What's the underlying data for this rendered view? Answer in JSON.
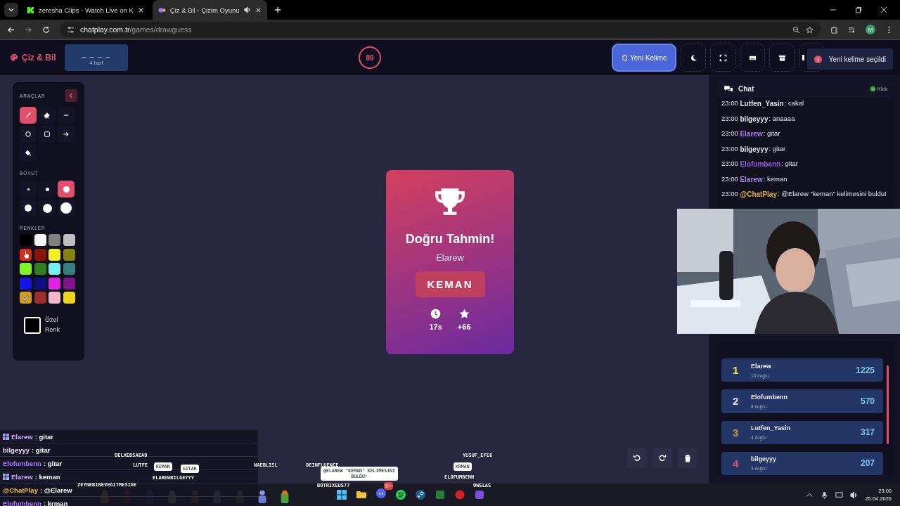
{
  "browser": {
    "tabs": [
      {
        "title": "zeresha Clips - Watch Live on K",
        "selected": false,
        "kind": "kick"
      },
      {
        "title": "Çiz & Bil - Çizim Oyunu",
        "selected": true,
        "kind": "cp"
      }
    ],
    "url_host": "chatplay.com.tr",
    "url_path": "/games/drawguess",
    "profile": "M"
  },
  "header": {
    "logo": "Çiz & Bil",
    "word": "_ _ _ _",
    "letters": "4 harf",
    "timer": "89",
    "new_word": "Yeni Kelime",
    "toast": "Yeni kelime seçildi"
  },
  "tools_panel": {
    "title": "ARAÇLAR",
    "tools": [
      {
        "kind": "brush",
        "selected": true
      },
      {
        "kind": "eraser",
        "selected": false
      },
      {
        "kind": "line",
        "selected": false
      },
      {
        "kind": "circle",
        "selected": false
      },
      {
        "kind": "rect",
        "selected": false
      },
      {
        "kind": "arrow",
        "selected": false
      },
      {
        "kind": "fill",
        "selected": false
      }
    ],
    "size_title": "BOYUT",
    "sizes": [
      {
        "selected": false
      },
      {
        "selected": false
      },
      {
        "selected": true
      },
      {
        "selected": false
      },
      {
        "selected": false
      },
      {
        "selected": false
      }
    ],
    "color_title": "RENKLER",
    "colors": [
      {
        "color": "#000000",
        "selected": false
      },
      {
        "color": "#f5f5f5",
        "selected": false
      },
      {
        "color": "#808080",
        "selected": false
      },
      {
        "color": "#c0c0c0",
        "selected": false
      },
      {
        "color": "#e02a14",
        "selected": false
      },
      {
        "color": "#8b1408",
        "selected": false
      },
      {
        "color": "#f2f020",
        "selected": false
      },
      {
        "color": "#848414",
        "selected": false
      },
      {
        "color": "#80f428",
        "selected": false
      },
      {
        "color": "#2f8020",
        "selected": false
      },
      {
        "color": "#74f0ee",
        "selected": false
      },
      {
        "color": "#348080",
        "selected": false
      },
      {
        "color": "#1414e0",
        "selected": false
      },
      {
        "color": "#101080",
        "selected": false
      },
      {
        "color": "#e024e4",
        "selected": false
      },
      {
        "color": "#80148c",
        "selected": false
      },
      {
        "color": "#d49a20",
        "selected": true
      },
      {
        "color": "#9c3030",
        "selected": false
      },
      {
        "color": "#f0b8c8",
        "selected": false
      },
      {
        "color": "#f0d21e",
        "selected": false
      }
    ],
    "custom_label": "Özel Renk"
  },
  "result_card": {
    "title": "Doğru Tahmin!",
    "player": "Elarew",
    "word": "KEMAN",
    "time": "17s",
    "points": "+66"
  },
  "chat": {
    "title": "Chat",
    "platform": "Kick",
    "messages": [
      {
        "time": "23:00",
        "user": "Lutfen_Yasin",
        "text": ": cakal",
        "color": "#e6e6ee"
      },
      {
        "time": "23:00",
        "user": "bilgeyyy",
        "text": ": anaaaa",
        "color": "#e6e6ee"
      },
      {
        "time": "23:00",
        "user": "Elarew",
        "text": ": gitar",
        "color": "#a77ee8"
      },
      {
        "time": "23:00",
        "user": "bilgeyyy",
        "text": ": gitar",
        "color": "#e6e6ee"
      },
      {
        "time": "23:00",
        "user": "Elofumbenn",
        "text": ": gitar",
        "color": "#9a5ae0"
      },
      {
        "time": "23:00",
        "user": "Elarew",
        "text": ": keman",
        "color": "#a77ee8"
      },
      {
        "time": "23:00",
        "user": "@ChatPlay",
        "text": ": @Elarew \"keman\" kelimesini buldu!",
        "color": "#e0b040"
      }
    ]
  },
  "leaderboard": [
    {
      "rank": "1",
      "name": "Elarew",
      "correct": "16 doğru",
      "score": "1225",
      "color": "#f2e64a"
    },
    {
      "rank": "2",
      "name": "Elofumbenn",
      "correct": "8 doğru",
      "score": "570",
      "color": "#dfe3ee"
    },
    {
      "rank": "3",
      "name": "Lutfen_Yasin",
      "correct": "4 doğru",
      "score": "317",
      "color": "#d3903c"
    },
    {
      "rank": "4",
      "name": "bilgeyyy",
      "correct": "3 doğru",
      "score": "207",
      "color": "#e0506e"
    }
  ],
  "stream_overlay": {
    "chat": [
      {
        "user": "Elarew",
        "text": ": gitar",
        "color": "#c8a0ff",
        "badge": true
      },
      {
        "user": "bilgeyyy",
        "text": ": gitar",
        "color": "#f0d8ff",
        "badge": false
      },
      {
        "user": "Elofumbenn",
        "text": ": gitar",
        "color": "#b070ff",
        "badge": false
      },
      {
        "user": "Elarew",
        "text": ": keman",
        "color": "#c8a0ff",
        "badge": true
      },
      {
        "user": "@ChatPlay",
        "text": ": @Elarew",
        "color": "#f0c040",
        "badge": false
      },
      {
        "user": "Elofumbenn",
        "text": ": krman",
        "color": "#b070ff",
        "badge": false
      }
    ],
    "names": [
      {
        "text": "DELXEDSAEAD",
        "kind": "name"
      },
      {
        "text": "LUTFE",
        "kind": "name"
      },
      {
        "text": "KEMAN",
        "kind": "bubble"
      },
      {
        "text": "GITAR",
        "kind": "bubble"
      },
      {
        "text": "ELAREWBILGEYYY",
        "kind": "name"
      },
      {
        "text": "ZEYNEBINEVEGITMESIGE",
        "kind": "name"
      },
      {
        "text": "NAEBLISL",
        "kind": "name"
      },
      {
        "text": "DEINFLUENCE",
        "kind": "name"
      },
      {
        "text": "@ELAREW \"KEMAN\" KELIMESINI BULDU!",
        "kind": "bubble"
      },
      {
        "text": "BOTRIXEUS77",
        "kind": "name"
      },
      {
        "text": "YUSUF_EFE6",
        "kind": "name"
      },
      {
        "text": "KRMAN",
        "kind": "bubble"
      },
      {
        "text": "ELOFUMBENN",
        "kind": "name"
      },
      {
        "text": "OWELAS",
        "kind": "name"
      }
    ]
  },
  "taskbar": {
    "time": "23:00",
    "date": "25.04.2026",
    "discord_badge": "9+"
  }
}
